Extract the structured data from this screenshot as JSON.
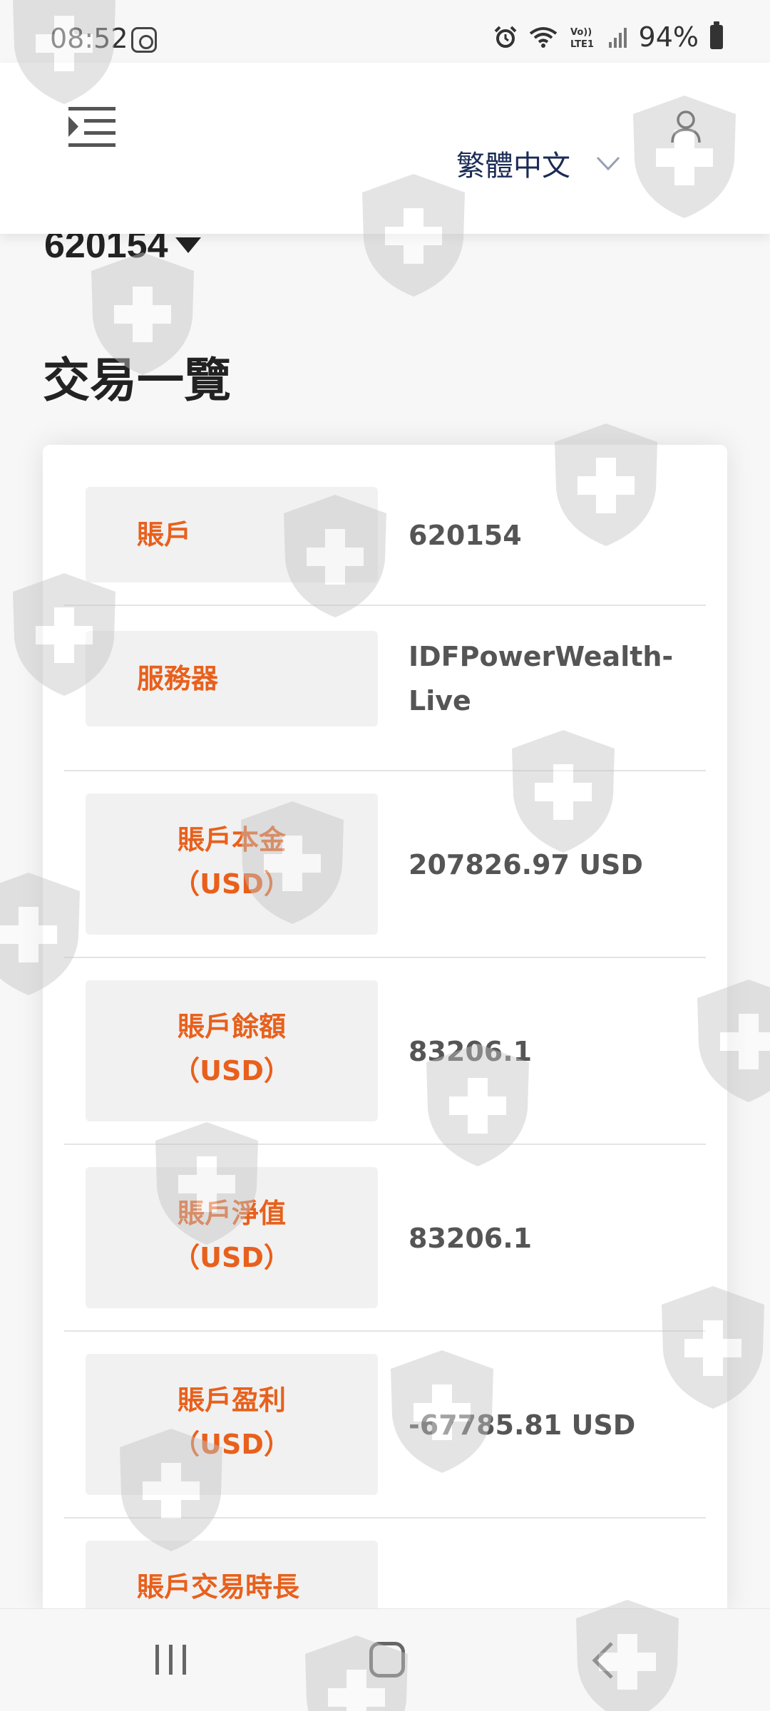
{
  "status_bar": {
    "time": "08:52",
    "battery": "94%",
    "icons": [
      "alarm-icon",
      "wifi-icon",
      "volte-icon",
      "signal-icon",
      "battery-icon"
    ],
    "volte_text": "Vo)) LTE1"
  },
  "header": {
    "menu_icon": "menu-icon",
    "language": "繁體中文",
    "user_icon": "user-icon"
  },
  "account": {
    "number": "620154"
  },
  "section_title": "交易一覽",
  "summary": {
    "rows": [
      {
        "label_line1": "賬戶",
        "label_line2": "",
        "value": "620154"
      },
      {
        "label_line1": "服務器",
        "label_line2": "",
        "value": "IDFPowerWealth-Live"
      },
      {
        "label_line1": "賬戶本金",
        "label_line2": "（USD）",
        "value": "207826.97 USD"
      },
      {
        "label_line1": "賬戶餘額",
        "label_line2": "（USD）",
        "value": "83206.1"
      },
      {
        "label_line1": "賬戶淨值",
        "label_line2": "（USD）",
        "value": "83206.1"
      },
      {
        "label_line1": "賬戶盈利",
        "label_line2": "（USD）",
        "value": "-67785.81 USD"
      },
      {
        "label_line1": "賬戶交易時長",
        "label_line2": "",
        "value": ""
      }
    ]
  },
  "colors": {
    "label_text": "#e8601c",
    "label_bg": "#f1f1f1",
    "value_text": "#555555",
    "language_text": "#1a2b55"
  },
  "nav_bar": {
    "icons": [
      "recent-apps-icon",
      "home-icon",
      "back-icon"
    ]
  }
}
